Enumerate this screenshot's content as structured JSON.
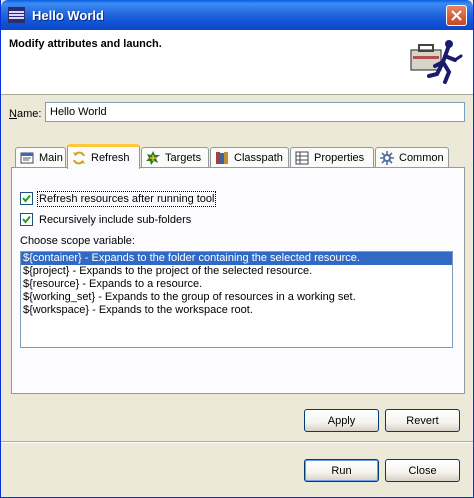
{
  "window": {
    "title": "Hello World"
  },
  "banner": {
    "message": "Modify attributes and launch."
  },
  "name_field": {
    "label_accel": "N",
    "label_rest": "ame:",
    "value": "Hello World"
  },
  "tabs": [
    {
      "label": "Main",
      "icon": "main-icon"
    },
    {
      "label": "Refresh",
      "icon": "refresh-icon",
      "active": true
    },
    {
      "label": "Targets",
      "icon": "targets-icon"
    },
    {
      "label": "Classpath",
      "icon": "classpath-icon"
    },
    {
      "label": "Properties",
      "icon": "properties-icon"
    },
    {
      "label": "Common",
      "icon": "common-icon"
    }
  ],
  "refresh": {
    "refresh_checkbox": {
      "label": "Refresh resources after running tool",
      "checked": true
    },
    "recursive_checkbox": {
      "label": "Recursively include sub-folders",
      "checked": true
    },
    "scope_label": "Choose scope variable:",
    "scope_items": [
      "${container} - Expands to the folder containing the selected resource.",
      "${project} - Expands to the project of the selected resource.",
      "${resource} - Expands to a resource.",
      "${working_set} - Expands to the group of resources in a working set.",
      "${workspace} - Expands to the workspace root."
    ],
    "selected_index": 0
  },
  "buttons": {
    "apply": "Apply",
    "revert": "Revert",
    "run": "Run",
    "close": "Close"
  },
  "colors": {
    "titlebar": "#0a48c8",
    "selection": "#316ac5",
    "face": "#ece9d8"
  }
}
